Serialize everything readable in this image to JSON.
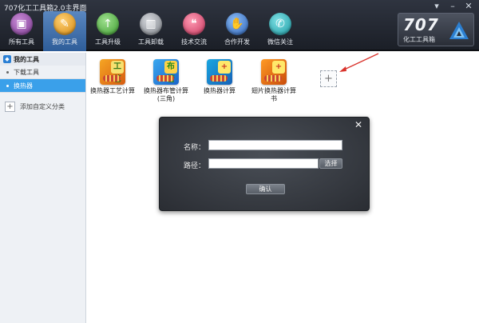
{
  "window": {
    "title": "707化工工具箱2.0主界面",
    "controls": [
      "▾",
      "–",
      "✕"
    ]
  },
  "toolbar": {
    "items": [
      {
        "label": "所有工具",
        "icon": "toolbox-icon"
      },
      {
        "label": "我的工具",
        "icon": "wrench-icon"
      },
      {
        "label": "工具升级",
        "icon": "upgrade-arrow-icon"
      },
      {
        "label": "工具卸载",
        "icon": "trash-icon"
      },
      {
        "label": "技术交流",
        "icon": "chat-icon"
      },
      {
        "label": "合作开发",
        "icon": "handshake-icon"
      },
      {
        "label": "微信关注",
        "icon": "wechat-icon"
      }
    ],
    "active_index": 1
  },
  "brand": {
    "number": "707",
    "subtitle": "化工工具箱"
  },
  "sidebar": {
    "header": "我的工具",
    "items": [
      {
        "label": "下载工具",
        "active": false
      },
      {
        "label": "换热器",
        "active": true
      }
    ],
    "add_label": "添加自定义分类",
    "add_symbol": "+"
  },
  "main": {
    "apps": [
      {
        "label": "换热器工艺计算",
        "glyph": "工艺"
      },
      {
        "label": "换热器布管计算(三角)",
        "glyph": "布管"
      },
      {
        "label": "换热器计算",
        "glyph": "+"
      },
      {
        "label": "翅片换热器计算书",
        "glyph": "+"
      }
    ],
    "add_symbol": "+"
  },
  "dialog": {
    "close_symbol": "✕",
    "name_label": "名称：",
    "name_value": "",
    "path_label": "路径：",
    "path_value": "",
    "browse_label": "选择",
    "confirm_label": "确认"
  },
  "colors": {
    "accent": "#3aa0ea",
    "toolbar_bg": "#2f3440",
    "arrow": "#d9322b"
  }
}
